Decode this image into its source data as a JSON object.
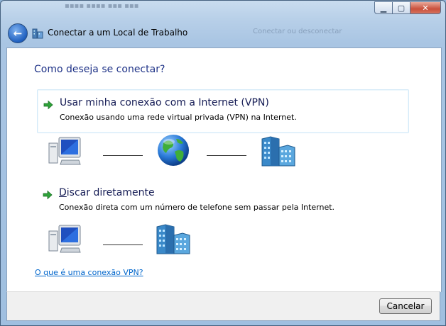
{
  "window": {
    "title": "Conectar a um Local de Trabalho",
    "ghost_title_text": "Conectar ou desconectar",
    "caption_buttons": [
      "minimize",
      "maximize",
      "close"
    ]
  },
  "heading": "Como deseja se conectar?",
  "options": [
    {
      "title": "Usar minha conexão com a Internet (VPN)",
      "description": "Conexão usando uma rede virtual privada (VPN) na Internet.",
      "diagram": [
        "computer-icon",
        "globe-icon",
        "office-building-icon"
      ]
    },
    {
      "title_accel": "D",
      "title_rest": "iscar diretamente",
      "description": "Conexão direta com um número de telefone sem passar pela Internet.",
      "diagram": [
        "computer-icon",
        "office-building-icon"
      ]
    }
  ],
  "help_link": "O que é uma conexão VPN?",
  "footer": {
    "cancel_label": "Cancelar"
  }
}
